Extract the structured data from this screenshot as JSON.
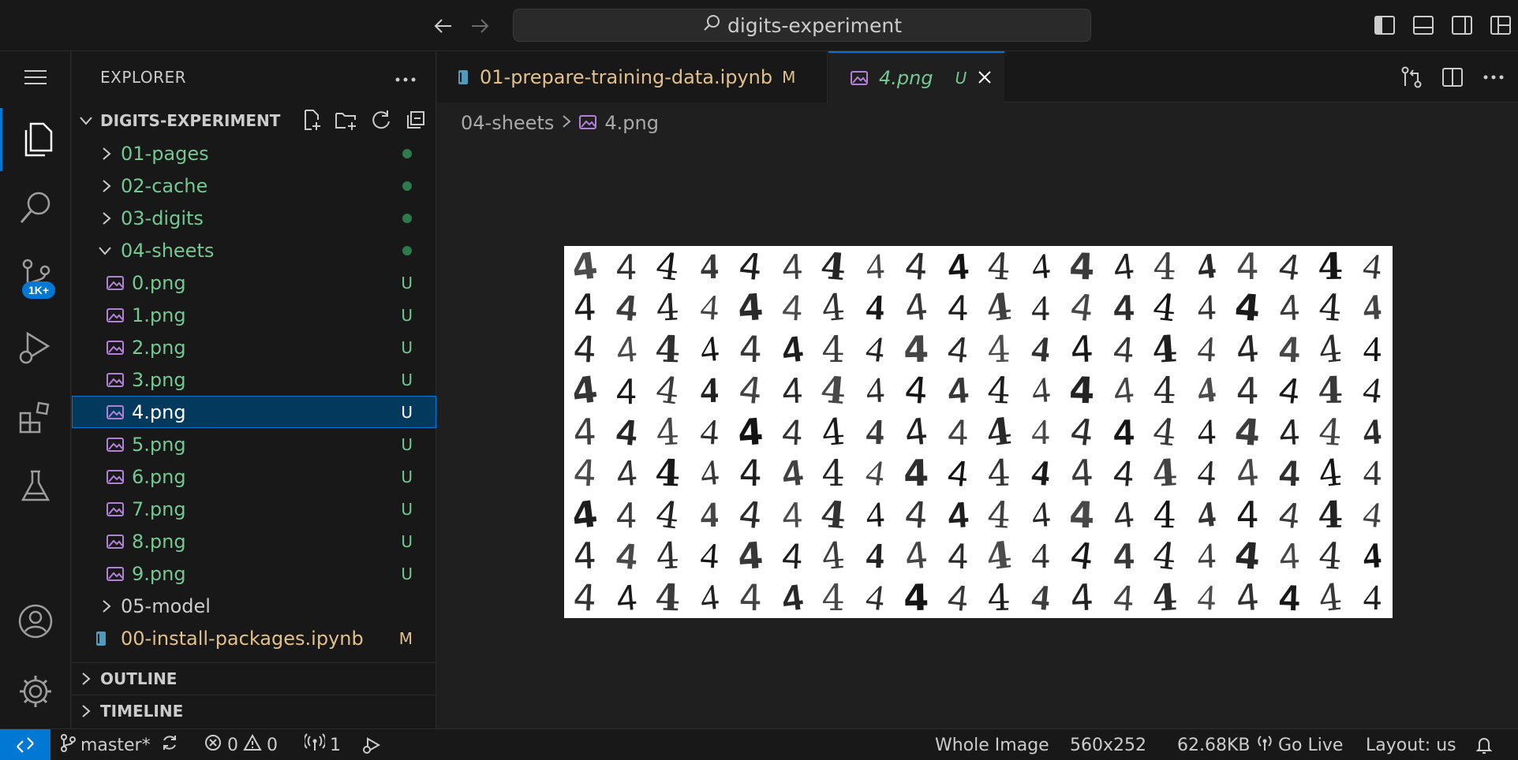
{
  "command_center": {
    "search_text": "digits-experiment"
  },
  "activity_bar": {
    "scm_badge": "1K+"
  },
  "sidebar": {
    "title": "EXPLORER",
    "root_label": "DIGITS-EXPERIMENT",
    "tree": [
      {
        "label": "01-pages",
        "type": "folder",
        "expanded": false,
        "status": "dot"
      },
      {
        "label": "02-cache",
        "type": "folder",
        "expanded": false,
        "status": "dot"
      },
      {
        "label": "03-digits",
        "type": "folder",
        "expanded": false,
        "status": "dot"
      },
      {
        "label": "04-sheets",
        "type": "folder",
        "expanded": true,
        "status": "dot"
      },
      {
        "label": "0.png",
        "type": "image",
        "status": "U"
      },
      {
        "label": "1.png",
        "type": "image",
        "status": "U"
      },
      {
        "label": "2.png",
        "type": "image",
        "status": "U"
      },
      {
        "label": "3.png",
        "type": "image",
        "status": "U"
      },
      {
        "label": "4.png",
        "type": "image",
        "status": "U",
        "selected": true
      },
      {
        "label": "5.png",
        "type": "image",
        "status": "U"
      },
      {
        "label": "6.png",
        "type": "image",
        "status": "U"
      },
      {
        "label": "7.png",
        "type": "image",
        "status": "U"
      },
      {
        "label": "8.png",
        "type": "image",
        "status": "U"
      },
      {
        "label": "9.png",
        "type": "image",
        "status": "U"
      },
      {
        "label": "05-model",
        "type": "folder",
        "expanded": false,
        "status": ""
      },
      {
        "label": "00-install-packages.ipynb",
        "type": "notebook",
        "status": "M"
      }
    ],
    "outline_label": "OUTLINE",
    "timeline_label": "TIMELINE"
  },
  "tabs": [
    {
      "label": "01-prepare-training-data.ipynb",
      "status": "M"
    },
    {
      "label": "4.png",
      "status": "U"
    }
  ],
  "breadcrumb": {
    "folder": "04-sheets",
    "file": "4.png"
  },
  "preview": {
    "glyph": "4"
  },
  "statusbar": {
    "branch": "master*",
    "errors": "0",
    "warnings": "0",
    "ports": "1",
    "zoom": "Whole Image",
    "dimensions": "560x252",
    "file_size": "62.68KB",
    "go_live": "Go Live",
    "layout": "Layout: us"
  },
  "colors": {
    "accent": "#0078d4",
    "untracked": "#73c991",
    "modified": "#e2c08d",
    "image_icon": "#b180d7",
    "notebook_icon": "#519aba"
  }
}
